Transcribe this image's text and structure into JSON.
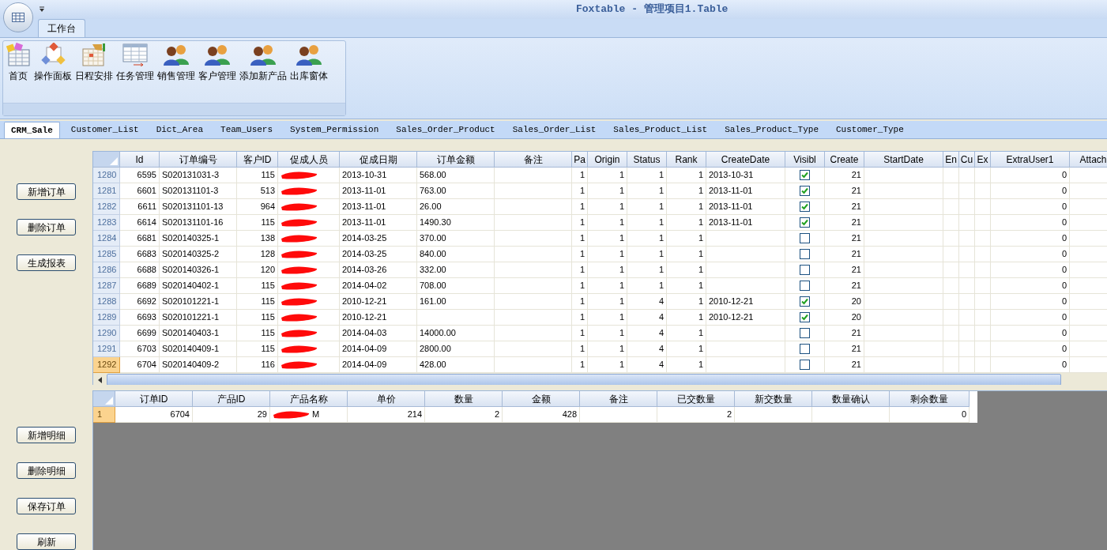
{
  "window": {
    "title": "Foxtable - 管理项目1.Table"
  },
  "ribbon": {
    "tabs": [
      {
        "label": "工作台",
        "selected": true
      }
    ],
    "buttons": [
      {
        "label": "首页",
        "kind": "home"
      },
      {
        "label": "操作面板",
        "kind": "panel"
      },
      {
        "label": "日程安排",
        "kind": "calendar"
      },
      {
        "label": "任务管理",
        "kind": "table"
      },
      {
        "label": "销售管理",
        "kind": "people"
      },
      {
        "label": "客户管理",
        "kind": "people"
      },
      {
        "label": "添加新产品",
        "kind": "people"
      },
      {
        "label": "出库窗体",
        "kind": "people"
      }
    ]
  },
  "sheet_tabs": [
    {
      "label": "CRM_Sale",
      "selected": true
    },
    {
      "label": "Customer_List",
      "selected": false
    },
    {
      "label": "Dict_Area",
      "selected": false
    },
    {
      "label": "Team_Users",
      "selected": false
    },
    {
      "label": "System_Permission",
      "selected": false
    },
    {
      "label": "Sales_Order_Product",
      "selected": false
    },
    {
      "label": "Sales_Order_List",
      "selected": false
    },
    {
      "label": "Sales_Product_List",
      "selected": false
    },
    {
      "label": "Sales_Product_Type",
      "selected": false
    },
    {
      "label": "Customer_Type",
      "selected": false
    }
  ],
  "order_buttons": [
    "新增订单",
    "删除订单",
    "生成报表"
  ],
  "orders_table": {
    "columns": [
      {
        "label": "Id",
        "kind": "text"
      },
      {
        "label": "订单编号",
        "kind": "text"
      },
      {
        "label": "客户ID",
        "kind": "text"
      },
      {
        "label": "促成人员",
        "kind": "redacted"
      },
      {
        "label": "促成日期",
        "kind": "text"
      },
      {
        "label": "订单金额",
        "kind": "text"
      },
      {
        "label": "备注",
        "kind": "text"
      },
      {
        "label": "Pa",
        "kind": "text"
      },
      {
        "label": "Origin",
        "kind": "text"
      },
      {
        "label": "Status",
        "kind": "text"
      },
      {
        "label": "Rank",
        "kind": "text"
      },
      {
        "label": "CreateDate",
        "kind": "text"
      },
      {
        "label": "Visibl",
        "kind": "check"
      },
      {
        "label": "Create",
        "kind": "text"
      },
      {
        "label": "StartDate",
        "kind": "text"
      },
      {
        "label": "En",
        "kind": "text"
      },
      {
        "label": "Cu",
        "kind": "text"
      },
      {
        "label": "Ex",
        "kind": "text"
      },
      {
        "label": "ExtraUser1",
        "kind": "text"
      },
      {
        "label": "Attach",
        "kind": "text"
      }
    ],
    "rows": [
      {
        "number": "1280",
        "selected": false,
        "checked": true,
        "cells": [
          "6595",
          "S020131031-3",
          "115",
          "",
          "2013-10-31",
          "568.00",
          "",
          "1",
          "1",
          "1",
          "1",
          "2013-10-31",
          "",
          "21",
          "",
          "",
          "",
          "",
          "0",
          ""
        ]
      },
      {
        "number": "1281",
        "selected": false,
        "checked": true,
        "cells": [
          "6601",
          "S020131101-3",
          "513",
          "",
          "2013-11-01",
          "763.00",
          "",
          "1",
          "1",
          "1",
          "1",
          "2013-11-01",
          "",
          "21",
          "",
          "",
          "",
          "",
          "0",
          ""
        ]
      },
      {
        "number": "1282",
        "selected": false,
        "checked": true,
        "cells": [
          "6611",
          "S020131101-13",
          "964",
          "",
          "2013-11-01",
          "26.00",
          "",
          "1",
          "1",
          "1",
          "1",
          "2013-11-01",
          "",
          "21",
          "",
          "",
          "",
          "",
          "0",
          ""
        ]
      },
      {
        "number": "1283",
        "selected": false,
        "checked": true,
        "cells": [
          "6614",
          "S020131101-16",
          "115",
          "",
          "2013-11-01",
          "1490.30",
          "",
          "1",
          "1",
          "1",
          "1",
          "2013-11-01",
          "",
          "21",
          "",
          "",
          "",
          "",
          "0",
          ""
        ]
      },
      {
        "number": "1284",
        "selected": false,
        "checked": false,
        "cells": [
          "6681",
          "S020140325-1",
          "138",
          "",
          "2014-03-25",
          "370.00",
          "",
          "1",
          "1",
          "1",
          "1",
          "",
          "",
          "21",
          "",
          "",
          "",
          "",
          "0",
          ""
        ]
      },
      {
        "number": "1285",
        "selected": false,
        "checked": false,
        "cells": [
          "6683",
          "S020140325-2",
          "128",
          "",
          "2014-03-25",
          "840.00",
          "",
          "1",
          "1",
          "1",
          "1",
          "",
          "",
          "21",
          "",
          "",
          "",
          "",
          "0",
          ""
        ]
      },
      {
        "number": "1286",
        "selected": false,
        "checked": false,
        "cells": [
          "6688",
          "S020140326-1",
          "120",
          "",
          "2014-03-26",
          "332.00",
          "",
          "1",
          "1",
          "1",
          "1",
          "",
          "",
          "21",
          "",
          "",
          "",
          "",
          "0",
          ""
        ]
      },
      {
        "number": "1287",
        "selected": false,
        "checked": false,
        "cells": [
          "6689",
          "S020140402-1",
          "115",
          "",
          "2014-04-02",
          "708.00",
          "",
          "1",
          "1",
          "1",
          "1",
          "",
          "",
          "21",
          "",
          "",
          "",
          "",
          "0",
          ""
        ]
      },
      {
        "number": "1288",
        "selected": false,
        "checked": true,
        "cells": [
          "6692",
          "S020101221-1",
          "115",
          "",
          "2010-12-21",
          "161.00",
          "",
          "1",
          "1",
          "4",
          "1",
          "2010-12-21",
          "",
          "20",
          "",
          "",
          "",
          "",
          "0",
          ""
        ]
      },
      {
        "number": "1289",
        "selected": false,
        "checked": true,
        "cells": [
          "6693",
          "S020101221-1",
          "115",
          "",
          "2010-12-21",
          "",
          "",
          "1",
          "1",
          "4",
          "1",
          "2010-12-21",
          "",
          "20",
          "",
          "",
          "",
          "",
          "0",
          ""
        ]
      },
      {
        "number": "1290",
        "selected": false,
        "checked": false,
        "cells": [
          "6699",
          "S020140403-1",
          "115",
          "",
          "2014-04-03",
          "14000.00",
          "",
          "1",
          "1",
          "4",
          "1",
          "",
          "",
          "21",
          "",
          "",
          "",
          "",
          "0",
          ""
        ]
      },
      {
        "number": "1291",
        "selected": false,
        "checked": false,
        "cells": [
          "6703",
          "S020140409-1",
          "115",
          "",
          "2014-04-09",
          "2800.00",
          "",
          "1",
          "1",
          "4",
          "1",
          "",
          "",
          "21",
          "",
          "",
          "",
          "",
          "0",
          ""
        ]
      },
      {
        "number": "1292",
        "selected": true,
        "checked": false,
        "cells": [
          "6704",
          "S020140409-2",
          "116",
          "",
          "2014-04-09",
          "428.00",
          "",
          "1",
          "1",
          "4",
          "1",
          "",
          "",
          "21",
          "",
          "",
          "",
          "",
          "0",
          ""
        ]
      }
    ]
  },
  "detail_buttons": [
    "新增明细",
    "删除明细",
    "保存订单",
    "刷新"
  ],
  "details_table": {
    "columns": [
      {
        "label": "订单ID",
        "kind": "text"
      },
      {
        "label": "产品ID",
        "kind": "text"
      },
      {
        "label": "产品名称",
        "kind": "redacted"
      },
      {
        "label": "单价",
        "kind": "text"
      },
      {
        "label": "数量",
        "kind": "text"
      },
      {
        "label": "金额",
        "kind": "text"
      },
      {
        "label": "备注",
        "kind": "text"
      },
      {
        "label": "已交数量",
        "kind": "text"
      },
      {
        "label": "新交数量",
        "kind": "text"
      },
      {
        "label": "数量确认",
        "kind": "text"
      },
      {
        "label": "剩余数量",
        "kind": "text"
      }
    ],
    "rows": [
      {
        "number": "1",
        "selected": true,
        "cells": [
          "6704",
          "29",
          "M",
          "214",
          "2",
          "428",
          "",
          "2",
          "",
          "",
          "0"
        ]
      }
    ]
  }
}
